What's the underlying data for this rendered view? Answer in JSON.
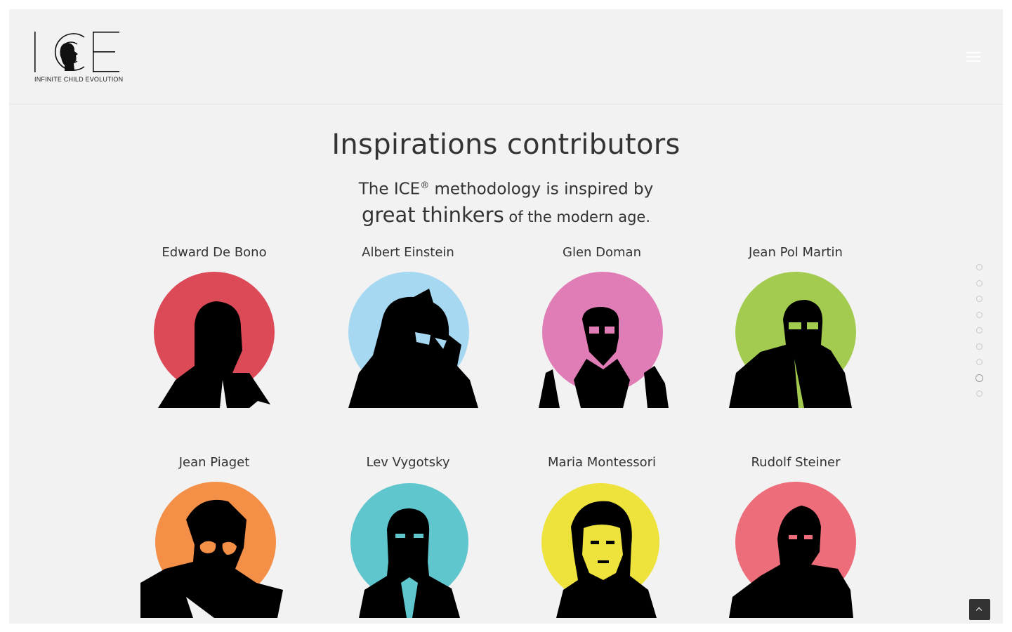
{
  "header": {
    "logo_text": "ICE",
    "logo_tagline": "INFINITE CHILD EVOLUTION",
    "menu_icon": "hamburger-menu-icon"
  },
  "section": {
    "title": "Inspirations contributors",
    "intro_part1": "The ICE",
    "intro_reg": "®",
    "intro_part2": " methodology is inspired by",
    "intro_emphasis": "great thinkers",
    "intro_part3": " of the modern age."
  },
  "contributors": [
    {
      "name": "Edward De Bono",
      "color": "#dc4a58"
    },
    {
      "name": "Albert Einstein",
      "color": "#a6d8f2"
    },
    {
      "name": "Glen Doman",
      "color": "#e17db6"
    },
    {
      "name": "Jean Pol Martin",
      "color": "#a3cb4f"
    },
    {
      "name": "Jean Piaget",
      "color": "#f48f47"
    },
    {
      "name": "Lev Vygotsky",
      "color": "#5fc6cd"
    },
    {
      "name": "Maria Montessori",
      "color": "#eee23c"
    },
    {
      "name": "Rudolf Steiner",
      "color": "#ee6d7b"
    }
  ],
  "side_nav": {
    "dot_count": 9,
    "active_index": 7
  },
  "back_to_top_icon": "chevron-up-icon"
}
